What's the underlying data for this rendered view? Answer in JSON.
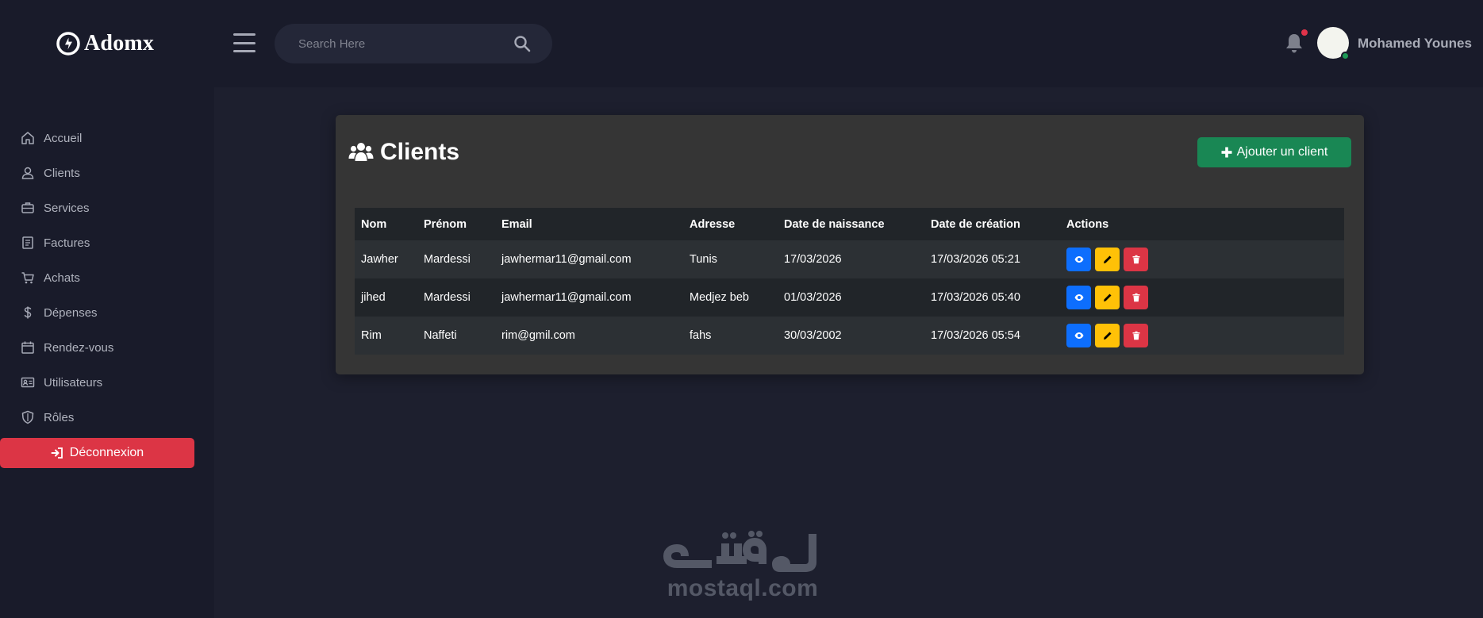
{
  "app": {
    "brand": "Adomx",
    "user_name": "Mohamed Younes",
    "search_placeholder": "Search Here"
  },
  "sidebar": {
    "items": [
      {
        "label": "Accueil",
        "icon": "home-icon"
      },
      {
        "label": "Clients",
        "icon": "user-icon"
      },
      {
        "label": "Services",
        "icon": "briefcase-icon"
      },
      {
        "label": "Factures",
        "icon": "receipt-icon"
      },
      {
        "label": "Achats",
        "icon": "cart-icon"
      },
      {
        "label": "Dépenses",
        "icon": "dollar-icon"
      },
      {
        "label": "Rendez-vous",
        "icon": "calendar-icon"
      },
      {
        "label": "Utilisateurs",
        "icon": "id-card-icon"
      },
      {
        "label": "Rôles",
        "icon": "shield-icon"
      }
    ],
    "logout_label": "Déconnexion"
  },
  "page": {
    "title": "Clients",
    "add_button_label": "Ajouter un client"
  },
  "table": {
    "headers": [
      "Nom",
      "Prénom",
      "Email",
      "Adresse",
      "Date de naissance",
      "Date de création",
      "Actions"
    ],
    "rows": [
      {
        "nom": "Jawher",
        "prenom": "Mardessi",
        "email": "jawhermar11@gmail.com",
        "adresse": "Tunis",
        "naissance": "17/03/2026",
        "creation": "17/03/2026 05:21"
      },
      {
        "nom": "jihed",
        "prenom": "Mardessi",
        "email": "jawhermar11@gmail.com",
        "adresse": "Medjez beb",
        "naissance": "01/03/2026",
        "creation": "17/03/2026 05:40"
      },
      {
        "nom": "Rim",
        "prenom": "Naffeti",
        "email": "rim@gmil.com",
        "adresse": "fahs",
        "naissance": "30/03/2002",
        "creation": "17/03/2026 05:54"
      }
    ]
  },
  "watermark": {
    "arabic": "مستقل",
    "latin": "mostaql.com"
  },
  "colors": {
    "background": "#191b2a",
    "card": "#353535",
    "primary": "#0d6efd",
    "success": "#198754",
    "warning": "#ffc107",
    "danger": "#dc3545"
  }
}
